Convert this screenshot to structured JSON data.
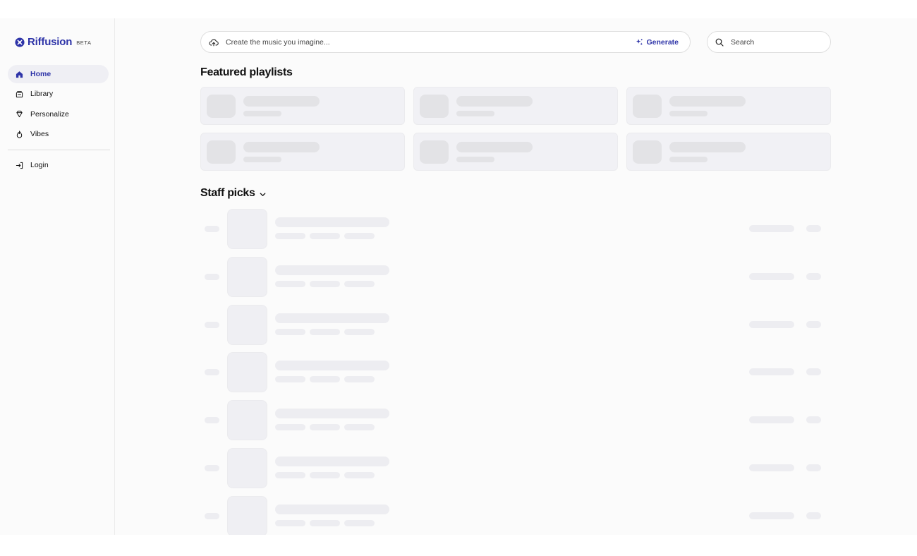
{
  "brand": {
    "name": "Riffusion",
    "badge": "BETA",
    "color": "#2e34a8"
  },
  "sidebar": {
    "items": [
      {
        "label": "Home",
        "icon": "home-icon",
        "active": true
      },
      {
        "label": "Library",
        "icon": "library-icon",
        "active": false
      },
      {
        "label": "Personalize",
        "icon": "gem-icon",
        "active": false
      },
      {
        "label": "Vibes",
        "icon": "flame-icon",
        "active": false
      }
    ],
    "login": {
      "label": "Login",
      "icon": "login-icon"
    }
  },
  "create": {
    "placeholder": "Create the music you imagine...",
    "generate_label": "Generate",
    "icon": "cloud-upload-icon",
    "generate_icon": "sparkle-icon"
  },
  "search": {
    "placeholder": "Search",
    "icon": "search-icon"
  },
  "featured": {
    "title": "Featured playlists"
  },
  "staff_picks": {
    "title": "Staff picks",
    "icon": "chevron-down-icon"
  },
  "colors": {
    "accent": "#2e34a8",
    "skeleton": "#ededf1",
    "card_bg": "#f1f1f5"
  }
}
